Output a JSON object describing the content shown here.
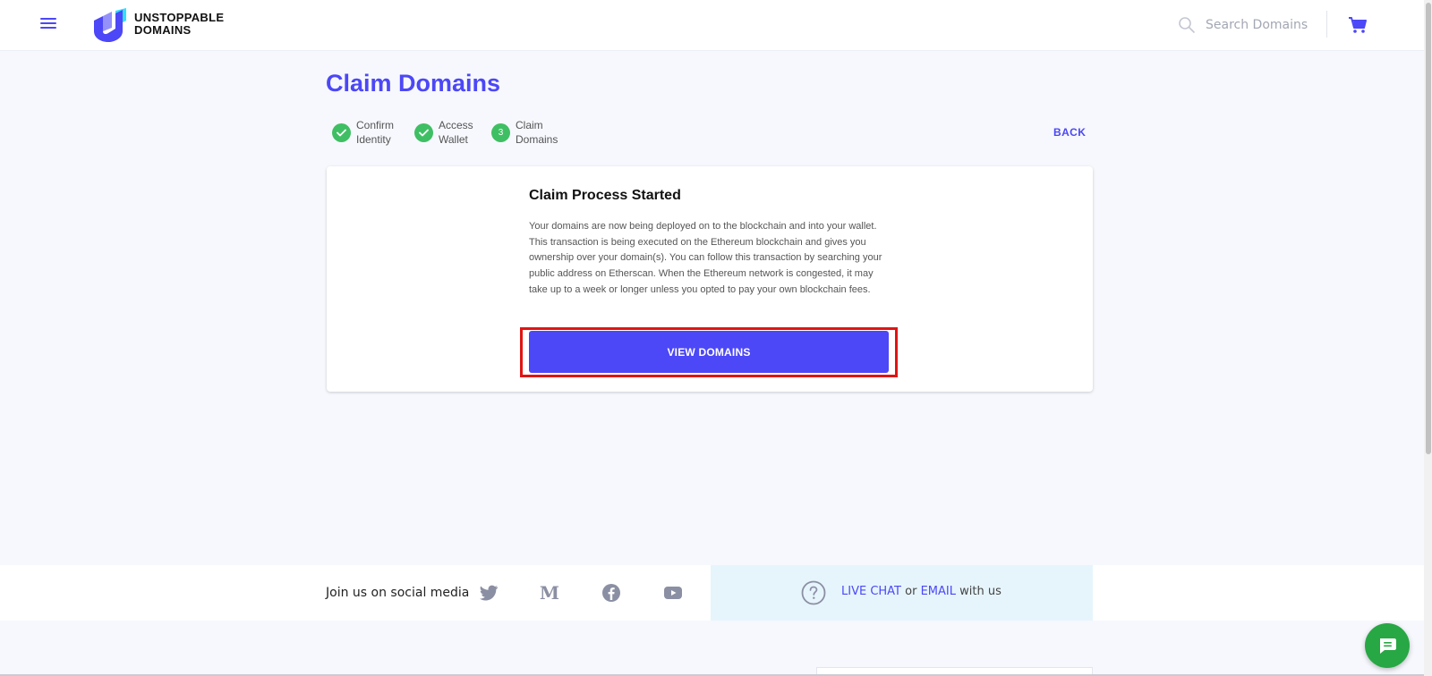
{
  "header": {
    "logo_line1": "UNSTOPPABLE",
    "logo_line2": "DOMAINS",
    "search_placeholder": "Search Domains",
    "menu_icon": "hamburger-menu-icon",
    "cart_icon": "shopping-cart-icon"
  },
  "page": {
    "title": "Claim Domains",
    "back_label": "BACK"
  },
  "stepper": {
    "steps": [
      {
        "line1": "Confirm",
        "line2": "Identity",
        "state": "complete"
      },
      {
        "line1": "Access",
        "line2": "Wallet",
        "state": "complete"
      },
      {
        "line1": "Claim",
        "line2": "Domains",
        "state": "current",
        "number": "3"
      }
    ]
  },
  "card": {
    "title": "Claim Process Started",
    "body": "Your domains are now being deployed on to the blockchain and into your wallet. This transaction is being executed on the Ethereum blockchain and gives you ownership over your domain(s). You can follow this transaction by searching your public address on Etherscan. When the Ethereum network is congested, it may take up to a week or longer unless you opted to pay your own blockchain fees.",
    "button_label": "VIEW DOMAINS"
  },
  "social": {
    "label": "Join us on social media",
    "icons": [
      "twitter-icon",
      "medium-icon",
      "facebook-icon",
      "youtube-icon"
    ]
  },
  "help": {
    "live_chat": "LIVE CHAT",
    "or": "or",
    "email": "EMAIL",
    "with_us": "with us"
  },
  "colors": {
    "brand": "#4c47f7",
    "success": "#3fbf63",
    "highlight": "#e01414",
    "chat": "#28a745",
    "help_bg": "#e6f5fc"
  }
}
